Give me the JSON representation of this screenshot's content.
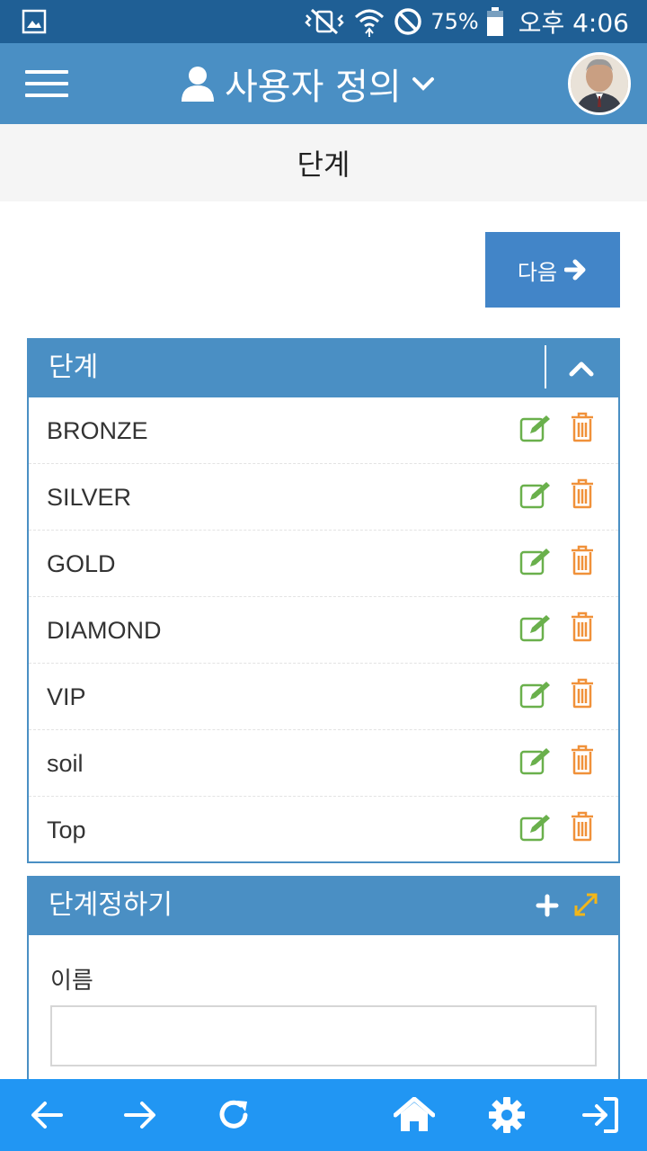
{
  "status_bar": {
    "battery_percent": "75%",
    "time": "오후 4:06",
    "icons": [
      "gallery-icon",
      "mute-vibrate-icon",
      "wifi-icon",
      "do-not-disturb-icon",
      "battery-icon"
    ]
  },
  "app_bar": {
    "title": "사용자 정의",
    "icons": [
      "hamburger-menu-icon",
      "user-icon",
      "chevron-down-icon"
    ]
  },
  "sub_header": {
    "title": "단계"
  },
  "next_button": {
    "label": "다음",
    "icon": "arrow-right-icon"
  },
  "levels_panel": {
    "title": "단계",
    "collapse_icon": "chevron-up-icon",
    "items": [
      {
        "name": "BRONZE"
      },
      {
        "name": "SILVER"
      },
      {
        "name": "GOLD"
      },
      {
        "name": "DIAMOND"
      },
      {
        "name": "VIP"
      },
      {
        "name": "soil"
      },
      {
        "name": "Top"
      }
    ],
    "row_icons": [
      "edit-icon",
      "trash-icon"
    ]
  },
  "define_panel": {
    "title": "단계정하기",
    "icons": [
      "plus-icon",
      "expand-icon"
    ],
    "name_label": "이름",
    "name_value": ""
  },
  "bottom_bar": {
    "icons": [
      "back-arrow-icon",
      "forward-arrow-icon",
      "refresh-icon",
      "home-icon",
      "settings-icon",
      "exit-icon"
    ]
  },
  "colors": {
    "status_bar": "#1f5f95",
    "app_bar": "#4a8fc4",
    "next_button": "#4285c8",
    "bottom_bar": "#2196f3",
    "edit_icon": "#6ab04c",
    "trash_icon": "#f0913a",
    "expand_icon": "#f2b619"
  }
}
